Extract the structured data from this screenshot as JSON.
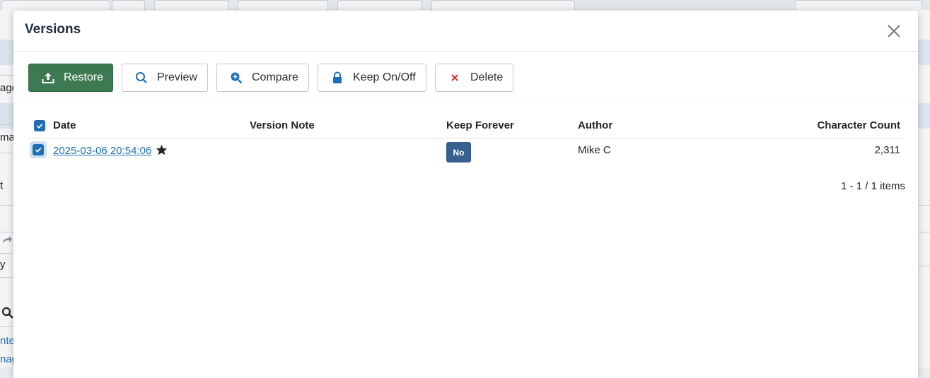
{
  "background": {
    "fragments": [
      "age",
      "ma",
      "t",
      "y",
      "nte",
      "nag"
    ]
  },
  "modal": {
    "title": "Versions",
    "close_icon": "close-icon"
  },
  "toolbar": {
    "buttons": [
      {
        "label": "Restore",
        "icon": "upload-icon"
      },
      {
        "label": "Preview",
        "icon": "search-icon"
      },
      {
        "label": "Compare",
        "icon": "zoom-in-icon"
      },
      {
        "label": "Keep On/Off",
        "icon": "lock-icon"
      },
      {
        "label": "Delete",
        "icon": "x-icon"
      }
    ]
  },
  "grid": {
    "columns": [
      "Date",
      "Version Note",
      "Keep Forever",
      "Author",
      "Character Count"
    ],
    "rows": [
      {
        "date": "2025-03-06 20:54:06",
        "version_note": "",
        "keep_forever": "No",
        "author": "Mike C",
        "character_count": "2,311",
        "selected": true,
        "starred": true
      }
    ],
    "pager": "1 - 1 / 1 items"
  },
  "colors": {
    "primary": "#3d7a52",
    "link": "#1f6fb5",
    "badge": "#37608e",
    "delete_icon": "#d32f2f"
  }
}
